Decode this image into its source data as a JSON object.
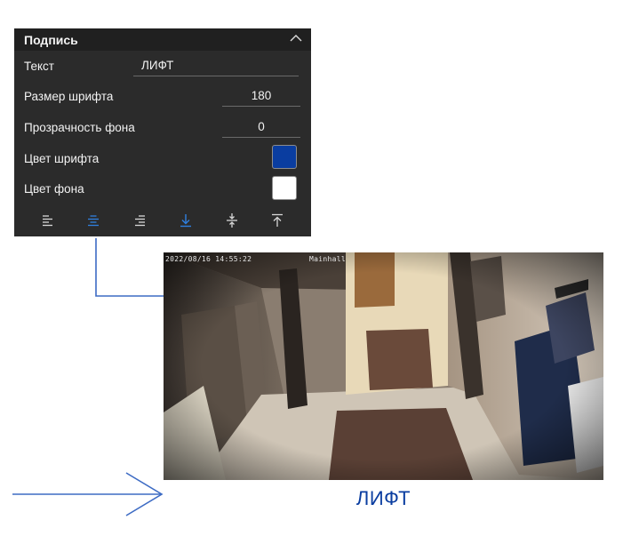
{
  "panel": {
    "title": "Подпись",
    "rows": {
      "text_label": "Текст",
      "text_value": "ЛИФТ",
      "font_size_label": "Размер шрифта",
      "font_size_value": "180",
      "bg_opacity_label": "Прозрачность фона",
      "bg_opacity_value": "0",
      "font_color_label": "Цвет шрифта",
      "font_color": "#0a3da0",
      "bg_color_label": "Цвет фона",
      "bg_color": "#ffffff"
    },
    "toolbar": [
      {
        "icon": "align-left-icon",
        "active": false
      },
      {
        "icon": "align-center-icon",
        "active": true
      },
      {
        "icon": "align-right-icon",
        "active": false
      },
      {
        "icon": "align-bottom-icon",
        "active": true
      },
      {
        "icon": "align-middle-icon",
        "active": false
      },
      {
        "icon": "align-top-icon",
        "active": false
      }
    ],
    "colors": {
      "background": "#2b2b2b",
      "header": "#202020",
      "accent": "#2f7fe0"
    }
  },
  "camera": {
    "timestamp": "2022/08/16 14:55:22",
    "camera_name": "Mainhall",
    "caption": "ЛИФТ",
    "caption_color": "#0a3da0"
  },
  "annotation": {
    "line_color": "#3d6bc4"
  }
}
